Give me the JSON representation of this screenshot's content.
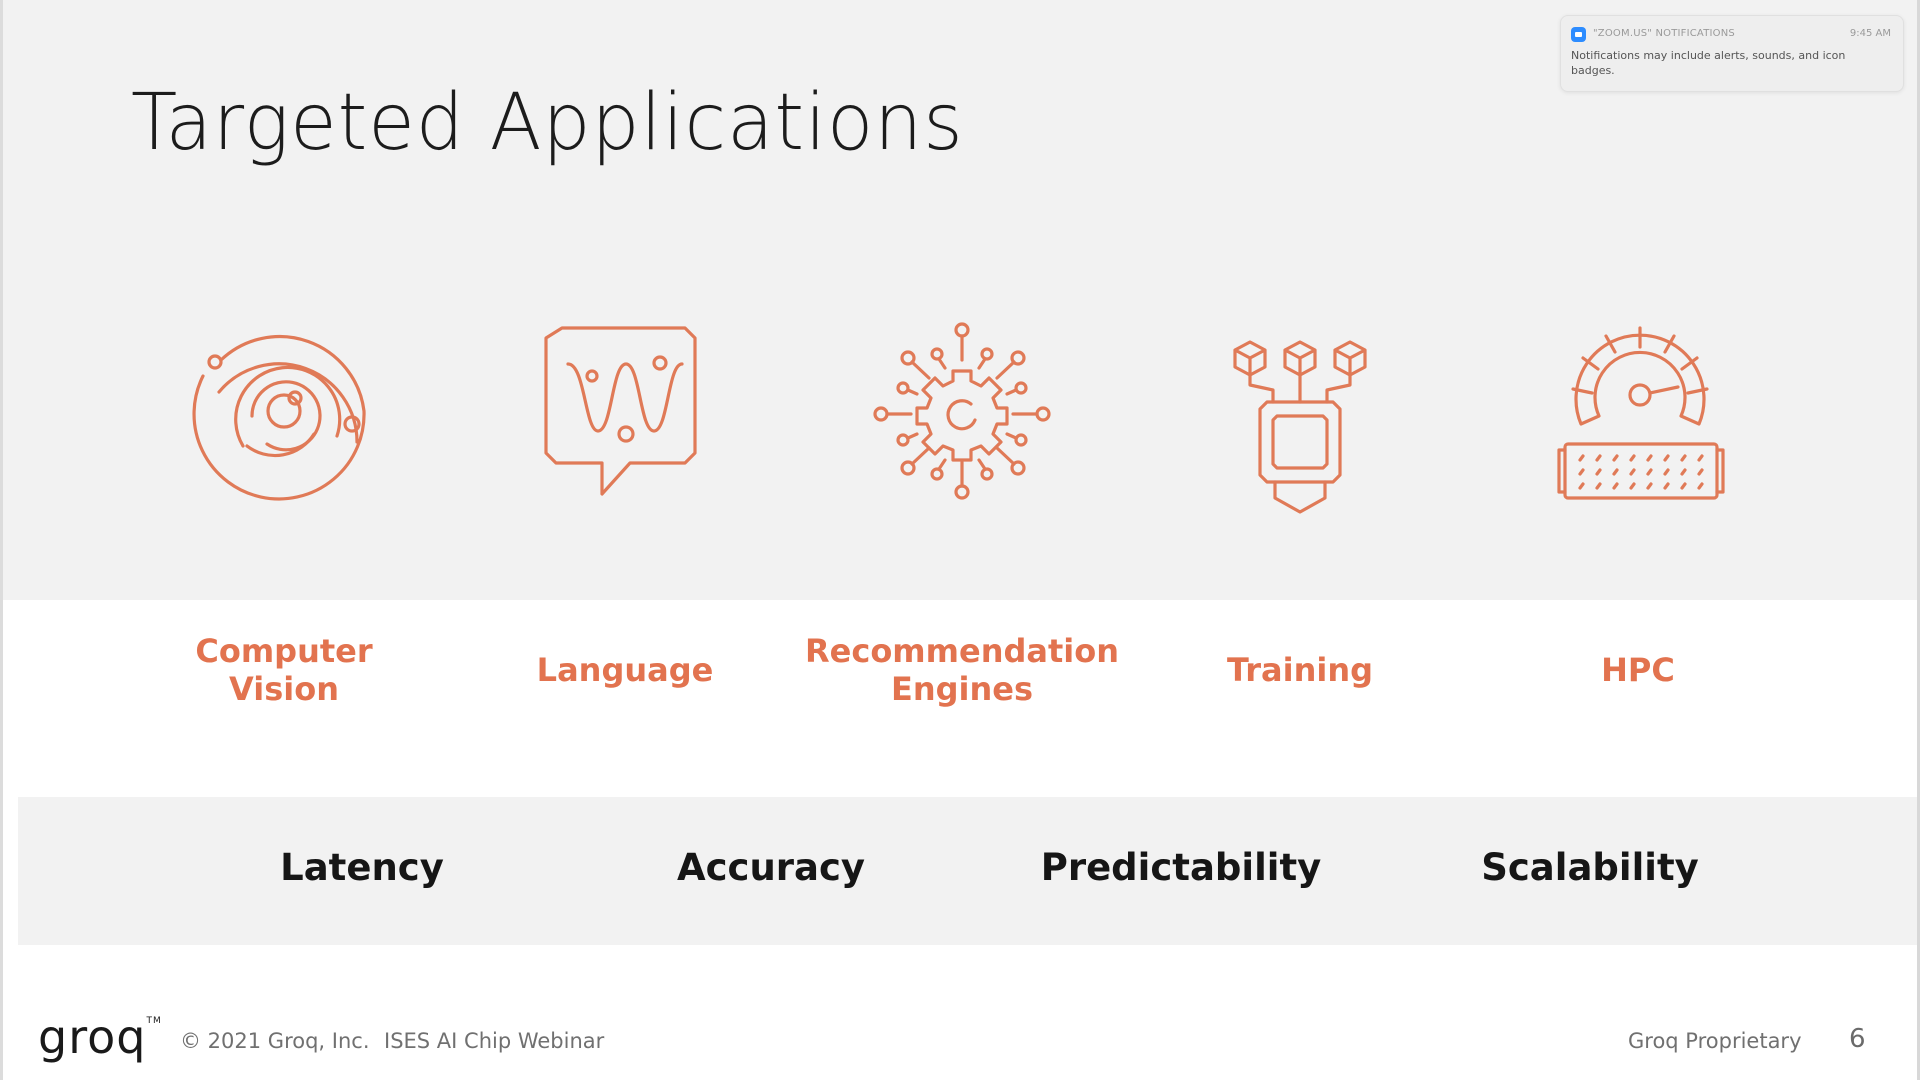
{
  "slide": {
    "title": "Targeted Applications",
    "page_number": "6"
  },
  "applications": [
    {
      "label_line1": "Computer",
      "label_line2": "Vision",
      "icon": "orbit-target-icon"
    },
    {
      "label_line1": "Language",
      "label_line2": "",
      "icon": "speech-bubble-wave-icon"
    },
    {
      "label_line1": "Recommendation",
      "label_line2": "Engines",
      "icon": "gear-network-icon"
    },
    {
      "label_line1": "Training",
      "label_line2": "",
      "icon": "cubes-chip-icon"
    },
    {
      "label_line1": "HPC",
      "label_line2": "",
      "icon": "speedometer-chip-icon"
    }
  ],
  "metrics": [
    "Latency",
    "Accuracy",
    "Predictability",
    "Scalability"
  ],
  "footer": {
    "logo": "groq",
    "copyright": "© 2021 Groq, Inc.",
    "event": "ISES AI Chip Webinar",
    "classification": "Groq Proprietary"
  },
  "notification": {
    "app": "\"ZOOM.US\" NOTIFICATIONS",
    "time": "9:45 AM",
    "body": "Notifications may include alerts, sounds, and icon badges."
  },
  "colors": {
    "accent": "#e2734f",
    "band": "#f2f2f2",
    "text": "#161616"
  }
}
